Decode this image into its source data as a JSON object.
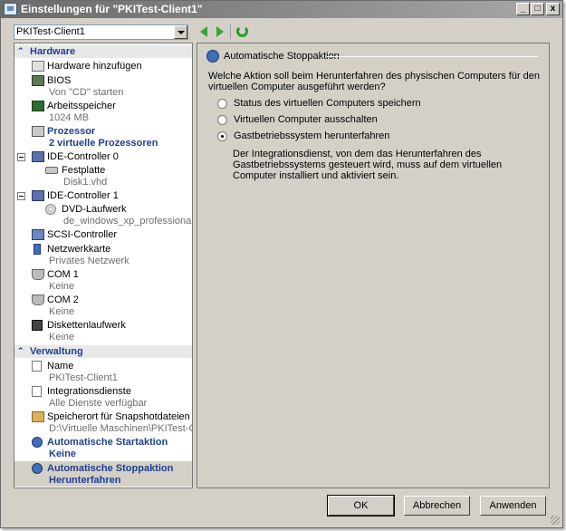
{
  "window": {
    "title": "Einstellungen für \"PKITest-Client1\"",
    "min_glyph": "_",
    "max_glyph": "□",
    "close_glyph": "x"
  },
  "vm_selector": {
    "value": "PKITest-Client1"
  },
  "toolbar": {
    "back_icon": "back-arrow-icon",
    "forward_icon": "forward-arrow-icon",
    "refresh_icon": "refresh-icon"
  },
  "sidebar": {
    "hardware_header": "Hardware",
    "management_header": "Verwaltung",
    "hardware_items": [
      {
        "label": "Hardware hinzufügen",
        "sub": "",
        "icon": "hardware-add-icon"
      },
      {
        "label": "BIOS",
        "sub": "Von \"CD\" starten",
        "icon": "bios-icon"
      },
      {
        "label": "Arbeitsspeicher",
        "sub": "1024 MB",
        "icon": "memory-icon"
      },
      {
        "label": "Prozessor",
        "sub": "2 virtuelle Prozessoren",
        "icon": "processor-icon"
      },
      {
        "label": "IDE-Controller 0",
        "sub": "",
        "icon": "ide-controller-icon"
      },
      {
        "label": "Festplatte",
        "sub": "Disk1.vhd",
        "icon": "hard-disk-icon"
      },
      {
        "label": "IDE-Controller 1",
        "sub": "",
        "icon": "ide-controller-icon"
      },
      {
        "label": "DVD-Laufwerk",
        "sub": "de_windows_xp_professional_...",
        "icon": "dvd-drive-icon"
      },
      {
        "label": "SCSI-Controller",
        "sub": "",
        "icon": "scsi-controller-icon"
      },
      {
        "label": "Netzwerkkarte",
        "sub": "Privates Netzwerk",
        "icon": "network-adapter-icon"
      },
      {
        "label": "COM 1",
        "sub": "Keine",
        "icon": "com-port-icon"
      },
      {
        "label": "COM 2",
        "sub": "Keine",
        "icon": "com-port-icon"
      },
      {
        "label": "Diskettenlaufwerk",
        "sub": "Keine",
        "icon": "floppy-drive-icon"
      }
    ],
    "management_items": [
      {
        "label": "Name",
        "sub": "PKITest-Client1",
        "icon": "name-icon"
      },
      {
        "label": "Integrationsdienste",
        "sub": "Alle Dienste verfügbar",
        "icon": "integration-services-icon"
      },
      {
        "label": "Speicherort für Snapshotdateien",
        "sub": "D:\\Virtuelle Maschinen\\PKITest-Cli...",
        "icon": "snapshot-folder-icon"
      },
      {
        "label": "Automatische Startaktion",
        "sub": "Keine",
        "icon": "auto-start-icon"
      },
      {
        "label": "Automatische Stoppaktion",
        "sub": "Herunterfahren",
        "icon": "auto-stop-icon"
      }
    ]
  },
  "detail": {
    "title": "Automatische Stoppaktion",
    "question": "Welche Aktion soll beim Herunterfahren des physischen Computers für den virtuellen Computer ausgeführt werden?",
    "options": [
      {
        "label": "Status des virtuellen Computers speichern",
        "checked": false
      },
      {
        "label": "Virtuellen Computer ausschalten",
        "checked": false
      },
      {
        "label": "Gastbetriebssystem herunterfahren",
        "checked": true
      }
    ],
    "description": "Der Integrationsdienst, von dem das Herunterfahren des Gastbetriebssystems gesteuert wird, muss auf dem virtuellen Computer installiert und aktiviert sein."
  },
  "buttons": {
    "ok": "OK",
    "cancel": "Abbrechen",
    "apply": "Anwenden"
  }
}
